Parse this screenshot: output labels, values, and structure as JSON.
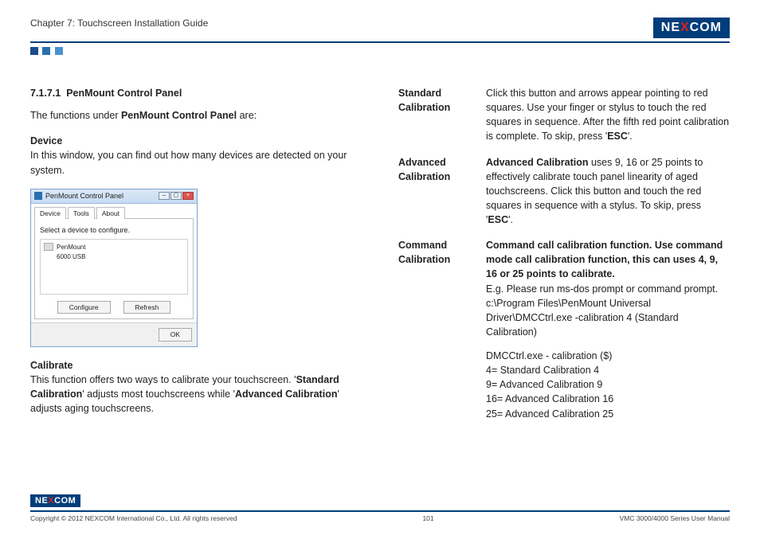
{
  "header": {
    "chapter": "Chapter 7: Touchscreen Installation Guide",
    "logo_pre": "NE",
    "logo_x": "X",
    "logo_post": "COM"
  },
  "left": {
    "section_number": "7.1.7.1",
    "section_title": "PenMount Control Panel",
    "intro_pre": "The functions under ",
    "intro_bold": "PenMount Control Panel",
    "intro_post": " are:",
    "device_head": "Device",
    "device_text": "In this window, you can find out how many devices are detected on your system.",
    "win": {
      "title": "PenMount Control Panel",
      "tab1": "Device",
      "tab2": "Tools",
      "tab3": "About",
      "select_label": "Select a device to configure.",
      "device_name": "PenMount",
      "device_sub": "6000 USB",
      "configure": "Configure",
      "refresh": "Refresh",
      "ok": "OK"
    },
    "cal_head": "Calibrate",
    "cal_pre": "This function offers two ways to calibrate your touchscreen. '",
    "cal_std": "Standard Calibration",
    "cal_mid": "' adjusts most touchscreens while '",
    "cal_adv": "Advanced Calibration",
    "cal_post": "' adjusts aging touchscreens."
  },
  "right": {
    "std_term": "Standard Calibration",
    "std_def_pre": "Click this button and arrows appear pointing to red squares. Use your finger or stylus to touch the red squares in sequence. After the fifth red point calibration is complete. To skip, press '",
    "std_def_esc": "ESC",
    "std_def_post": "'.",
    "adv_term": "Advanced Calibration",
    "adv_bold": "Advanced Calibration",
    "adv_def_pre": " uses 9, 16 or 25 points to effectively calibrate touch panel linearity of aged touchscreens. Click this button and touch the red squares in sequence with a stylus. To skip, press '",
    "adv_def_esc": "ESC",
    "adv_def_post": "'.",
    "cmd_term": "Command Calibration",
    "cmd_bold": "Command call calibration function. Use command mode call calibration function, this can uses 4, 9, 16 or 25 points to calibrate.",
    "cmd_eg1": "E.g. Please run ms-dos prompt or command prompt.",
    "cmd_eg2": "c:\\Program Files\\PenMount Universal Driver\\DMCCtrl.exe -calibration 4 (Standard Calibration)",
    "list_head": "DMCCtrl.exe - calibration ($)",
    "list_4": "4= Standard Calibration 4",
    "list_9": "9= Advanced Calibration 9",
    "list_16": "16= Advanced Calibration 16",
    "list_25": "25= Advanced Calibration 25"
  },
  "footer": {
    "copyright": "Copyright © 2012 NEXCOM International Co., Ltd. All rights reserved",
    "page": "101",
    "manual": "VMC 3000/4000 Series User Manual"
  }
}
